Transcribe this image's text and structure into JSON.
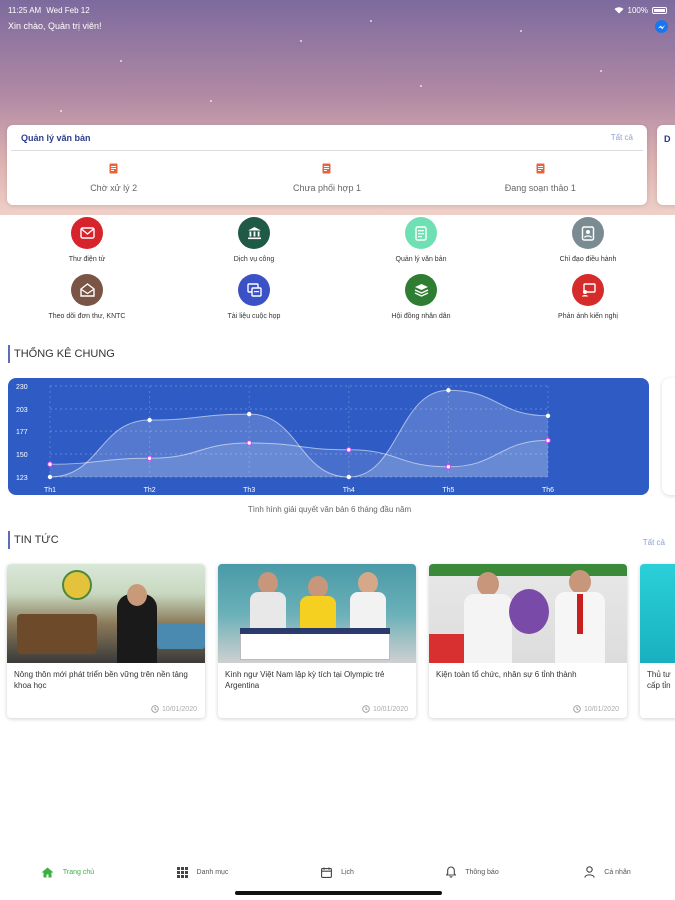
{
  "status": {
    "time": "11:25 AM",
    "date": "Wed Feb 12",
    "battery": "100%"
  },
  "greeting": "Xin chào, Quản trị viên!",
  "doc_card": {
    "title": "Quản lý văn bản",
    "view_all": "Tất cả",
    "items": [
      {
        "label": "Chờ xử lý 2",
        "icon": "document-icon"
      },
      {
        "label": "Chưa phối hợp 1",
        "icon": "document-icon"
      },
      {
        "label": "Đang soạn thảo 1",
        "icon": "document-icon"
      }
    ],
    "next_card_initial": "D"
  },
  "shortcuts": [
    {
      "label": "Thư điện tử",
      "icon": "mail-icon",
      "color": "#d6232c"
    },
    {
      "label": "Dịch vụ công",
      "icon": "bank-icon",
      "color": "#1e5a45"
    },
    {
      "label": "Quản lý văn bản",
      "icon": "document-icon",
      "color": "#6fe0b3"
    },
    {
      "label": "Chỉ đạo điều hành",
      "icon": "directive-icon",
      "color": "#7a8c92"
    },
    {
      "label": "Theo dõi đơn thư, KNTC",
      "icon": "letter-icon",
      "color": "#7a5444"
    },
    {
      "label": "Tài liệu cuộc họp",
      "icon": "meeting-docs-icon",
      "color": "#3b52c6"
    },
    {
      "label": "Hội đồng nhân dân",
      "icon": "layers-icon",
      "color": "#2e7d32"
    },
    {
      "label": "Phản ánh kiến nghị",
      "icon": "feedback-icon",
      "color": "#d62b2b"
    }
  ],
  "stats": {
    "section_title": "THỐNG KÊ CHUNG",
    "caption": "Tình hình giải quyết văn bản 6 tháng đầu năm"
  },
  "chart_data": {
    "type": "area",
    "categories": [
      "Th1",
      "Th2",
      "Th3",
      "Th4",
      "Th5",
      "Th6"
    ],
    "y_ticks": [
      123,
      150,
      177,
      203,
      230
    ],
    "ylim": [
      123,
      230
    ],
    "series": [
      {
        "values": [
          123,
          190,
          197,
          123,
          225,
          195
        ],
        "color": "#ffffff"
      },
      {
        "values": [
          138,
          145,
          163,
          155,
          135,
          166
        ],
        "color": "#e040fb"
      }
    ],
    "grid": true
  },
  "news": {
    "section_title": "TIN TỨC",
    "view_all": "Tất cả",
    "items": [
      {
        "title": "Nông thôn mới phát triển bền vững trên nền tảng khoa học",
        "date": "10/01/2020"
      },
      {
        "title": "Kình ngư Việt Nam lập kỳ tích tại Olympic trẻ Argentina",
        "date": "10/01/2020"
      },
      {
        "title": "Kiện toàn tổ chức, nhân sự 6 tỉnh thành",
        "date": "10/01/2020"
      },
      {
        "title": "Thủ tư cấp tỉn",
        "date": ""
      }
    ]
  },
  "tabs": [
    {
      "label": "Trang chủ",
      "icon": "home-icon",
      "active": true
    },
    {
      "label": "Danh mục",
      "icon": "grid-icon",
      "active": false
    },
    {
      "label": "Lịch",
      "icon": "calendar-icon",
      "active": false
    },
    {
      "label": "Thông báo",
      "icon": "bell-icon",
      "active": false
    },
    {
      "label": "Cá nhân",
      "icon": "user-icon",
      "active": false
    }
  ],
  "colors": {
    "accent": "#2f5cc4",
    "active_tab": "#3cb043",
    "link": "#8aa0d8"
  }
}
